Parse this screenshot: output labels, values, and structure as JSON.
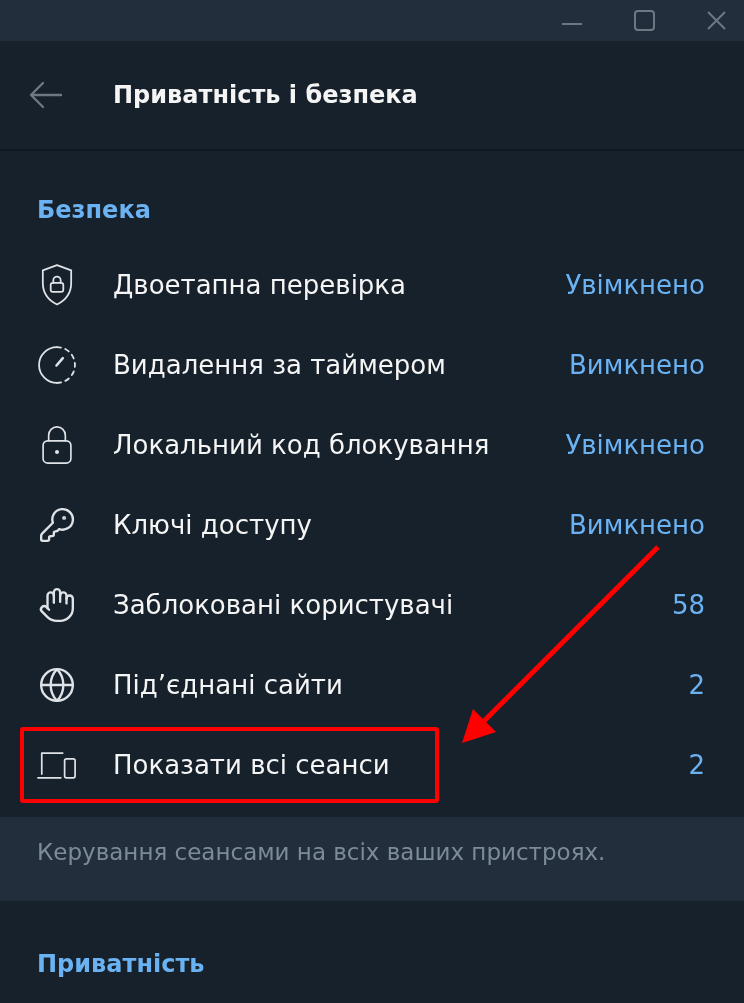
{
  "header": {
    "title": "Приватність і безпека"
  },
  "sections": [
    {
      "title": "Безпека",
      "rows": [
        {
          "label": "Двоетапна перевірка",
          "value": "Увімкнено",
          "highlighted": false
        },
        {
          "label": "Видалення за таймером",
          "value": "Вимкнено",
          "highlighted": false
        },
        {
          "label": "Локальний код блокування",
          "value": "Увімкнено",
          "highlighted": false
        },
        {
          "label": "Ключі доступу",
          "value": "Вимкнено",
          "highlighted": false
        },
        {
          "label": "Заблоковані користувачі",
          "value": "58",
          "highlighted": false
        },
        {
          "label": "Під’єднані сайти",
          "value": "2",
          "highlighted": false
        },
        {
          "label": "Показати всі сеанси",
          "value": "2",
          "highlighted": true
        }
      ],
      "note": "Керування сеансами на всіх ваших пристроях."
    },
    {
      "title": "Приватність"
    }
  ]
}
